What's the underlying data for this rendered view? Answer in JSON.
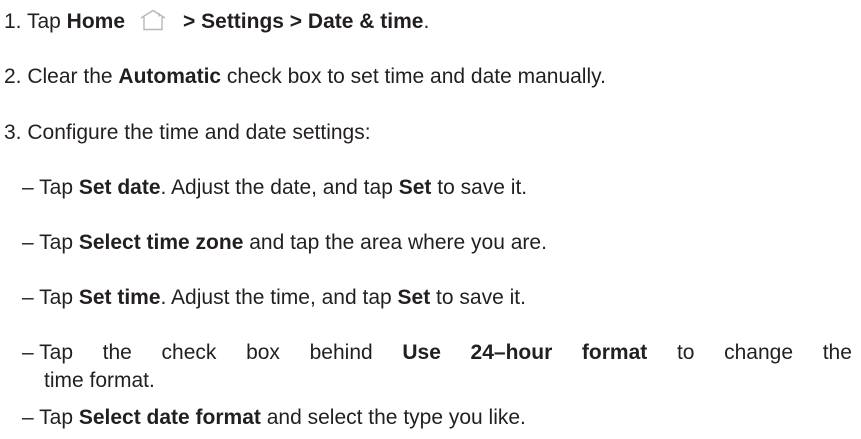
{
  "steps": {
    "s1": {
      "prefix": "1. Tap ",
      "home": "Home",
      "home_icon": "home-icon",
      "path": "> Settings > Date & time",
      "end": "."
    },
    "s2": {
      "prefix": "2. Clear the ",
      "bold": "Automatic",
      "rest": " check box to set time and date manually."
    },
    "s3": {
      "text": "3. Configure the time and date settings:"
    }
  },
  "bullets": {
    "b1": {
      "prefix": "– Tap ",
      "bold1": "Set date",
      "mid": ". Adjust the date, and tap ",
      "bold2": "Set",
      "rest": " to save it."
    },
    "b2": {
      "prefix": "– Tap ",
      "bold1": "Select time zone",
      "rest": " and tap the area where you are."
    },
    "b3": {
      "prefix": "– Tap ",
      "bold1": "Set time",
      "mid": ". Adjust the time, and tap ",
      "bold2": "Set",
      "rest": " to save it."
    },
    "b4": {
      "w1": "– Tap",
      "w2": "the",
      "w3": "check",
      "w4": "box",
      "w5": "behind",
      "w6": "Use",
      "w7": "24–hour",
      "w8": "format",
      "w9": "to",
      "w10": "change",
      "w11": "the",
      "line2": "time format."
    },
    "b5": {
      "prefix": "– Tap ",
      "bold1": "Select date format",
      "rest": " and select the type you like."
    }
  },
  "colors": {
    "text": "#231f20",
    "icon": "#b8b8b8"
  }
}
